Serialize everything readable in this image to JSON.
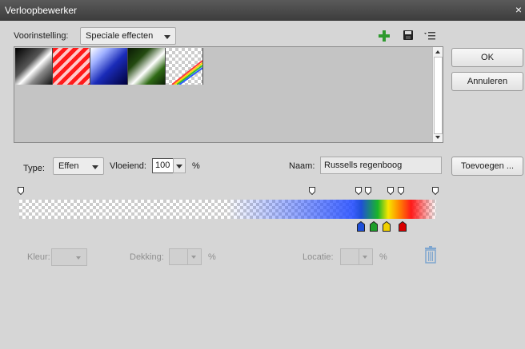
{
  "window": {
    "title": "Verloopbewerker",
    "close": "×"
  },
  "preset": {
    "label": "Voorinstelling:",
    "value": "Speciale effecten"
  },
  "toolbar_icons": [
    "plus-icon",
    "save-icon",
    "menu-icon"
  ],
  "buttons": {
    "ok": "OK",
    "cancel": "Annuleren",
    "add": "Toevoegen ..."
  },
  "type": {
    "label": "Type:",
    "value": "Effen"
  },
  "smoothness": {
    "label": "Vloeiend:",
    "value": "100",
    "unit": "%"
  },
  "name": {
    "label": "Naam:",
    "value": "Russells regenboog"
  },
  "stops": {
    "color_label": "Kleur:",
    "opacity_label": "Dekking:",
    "opacity_unit": "%",
    "location_label": "Locatie:",
    "location_unit": "%"
  },
  "colors": {
    "accent": "#1a73e8",
    "color_stops": [
      "#1f4fd8",
      "#1e9e2a",
      "#f0d000",
      "#d80000"
    ]
  }
}
